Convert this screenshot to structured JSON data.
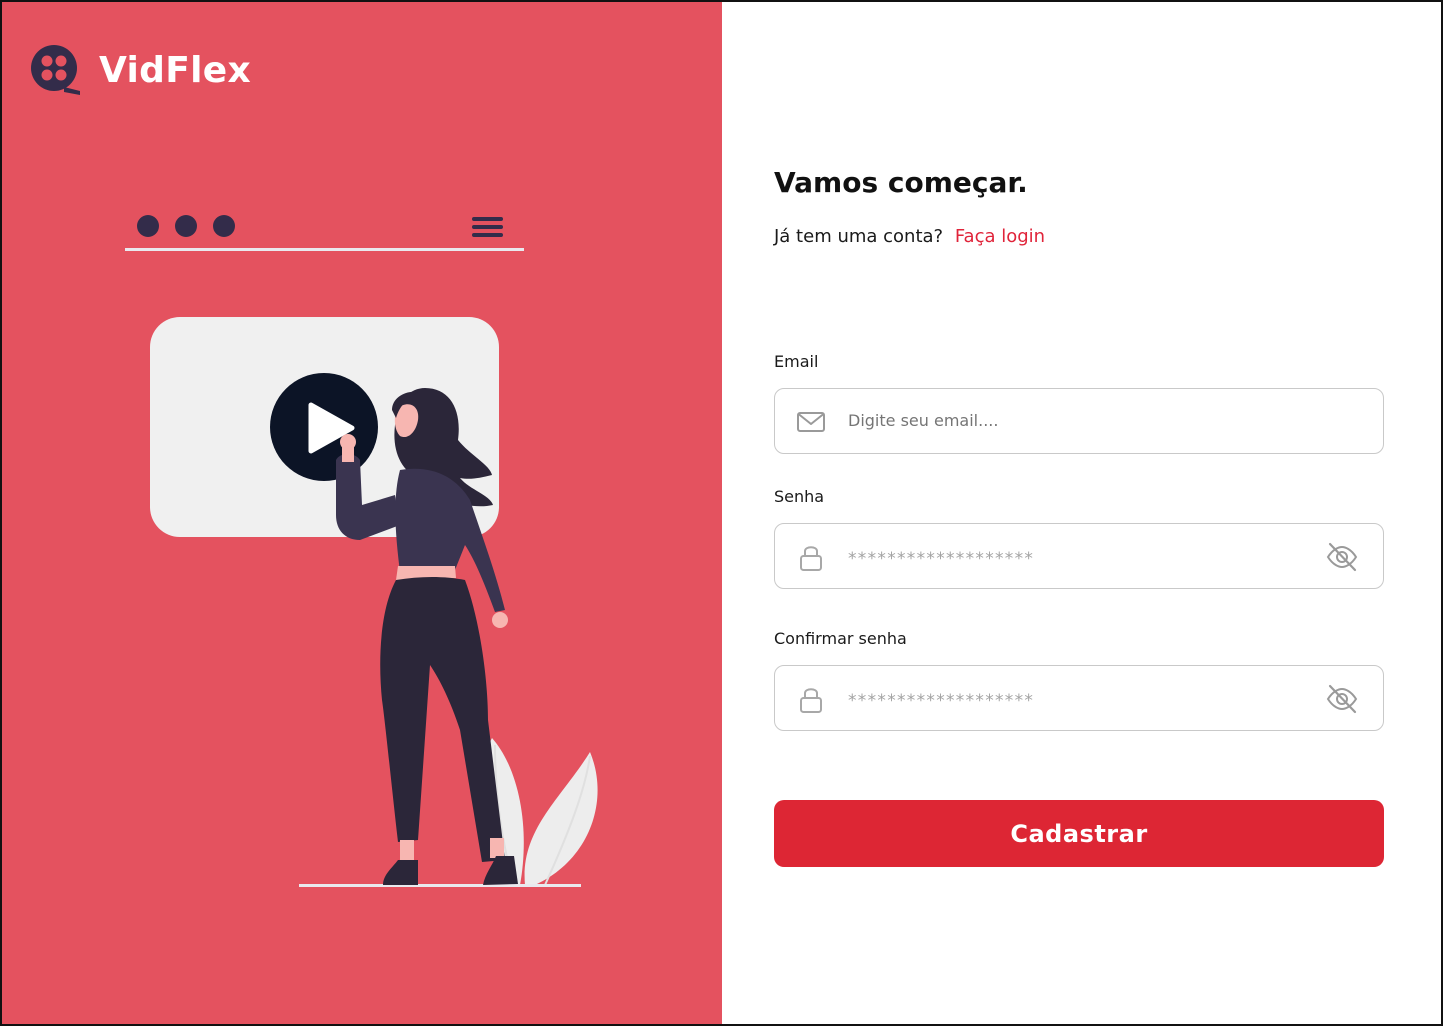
{
  "brand": {
    "name": "VidFlex"
  },
  "colors": {
    "panel_bg": "#E4525F",
    "accent": "#DD2634",
    "link": "#E0243A",
    "dark_figure": "#2B2639",
    "play_button": "#0C1426",
    "screen_bg": "#F0F0F0"
  },
  "auth": {
    "heading": "Vamos começar.",
    "prompt": "Já tem uma conta?",
    "login_link": "Faça login"
  },
  "form": {
    "email": {
      "label": "Email",
      "placeholder": "Digite seu email....",
      "icon": "mail-icon"
    },
    "password": {
      "label": "Senha",
      "masked_value": "*******************",
      "icon": "lock-icon",
      "toggle_icon": "eye-off-icon"
    },
    "confirm_password": {
      "label": "Confirmar senha",
      "masked_value": "*******************",
      "icon": "lock-icon",
      "toggle_icon": "eye-off-icon"
    },
    "submit_label": "Cadastrar"
  }
}
